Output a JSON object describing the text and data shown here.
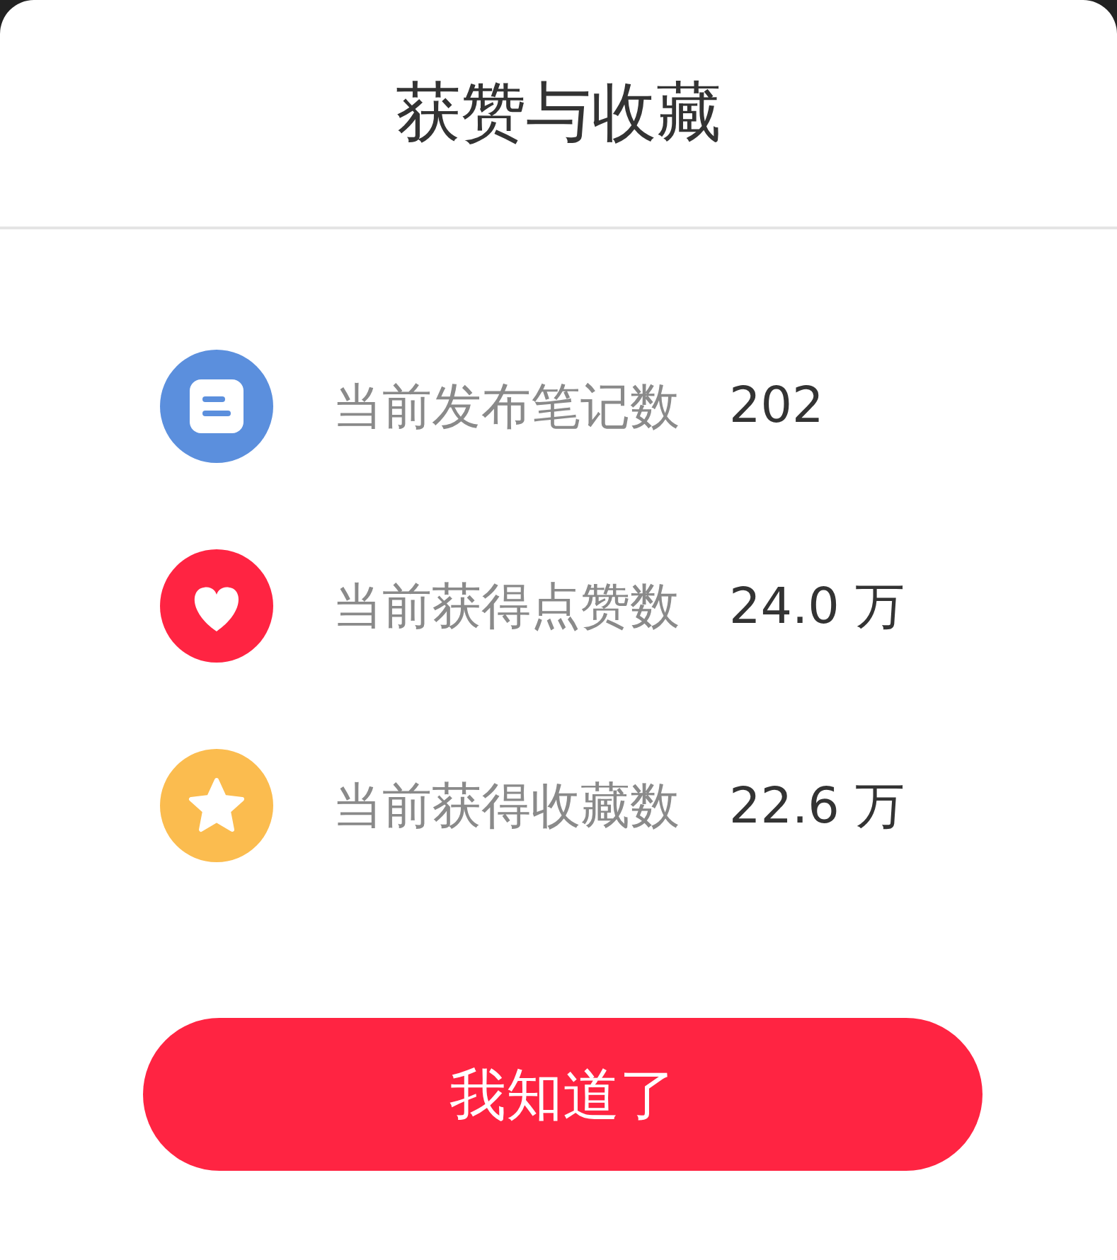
{
  "dialog": {
    "title": "获赞与收藏",
    "stats": [
      {
        "kind": "notes",
        "label": "当前发布笔记数",
        "value": "202"
      },
      {
        "kind": "likes",
        "label": "当前获得点赞数",
        "value": "24.0 万"
      },
      {
        "kind": "favorites",
        "label": "当前获得收藏数",
        "value": "22.6 万"
      }
    ],
    "button": "我知道了"
  }
}
